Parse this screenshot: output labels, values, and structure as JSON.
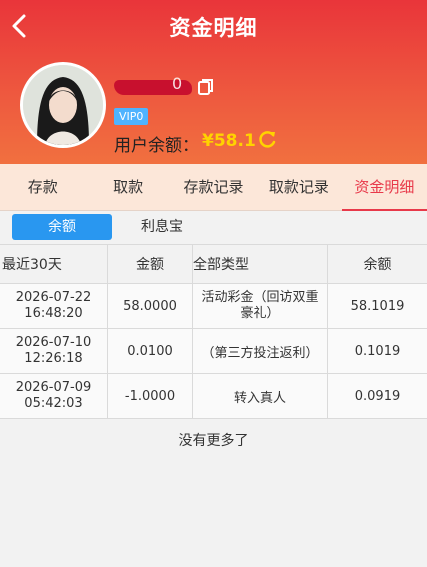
{
  "header": {
    "title": "资金明细",
    "username_suffix": "0",
    "vip": "VIP0",
    "balance_label": "用户余额：",
    "balance_value": "¥58.1"
  },
  "tabs": [
    "存款",
    "取款",
    "存款记录",
    "取款记录",
    "资金明细"
  ],
  "subtabs": [
    "余额",
    "利息宝"
  ],
  "table": {
    "headers": [
      "最近30天",
      "金额",
      "全部类型",
      "余额"
    ],
    "rows": [
      {
        "date": "2026-07-22",
        "time": "16:48:20",
        "amount": "58.0000",
        "type_line1": "活动彩金（回访双重",
        "type_line2": "豪礼）",
        "balance": "58.1019"
      },
      {
        "date": "2026-07-10",
        "time": "12:26:18",
        "amount": "0.0100",
        "type_line1": "（第三方投注返利）",
        "type_line2": "",
        "balance": "0.1019"
      },
      {
        "date": "2026-07-09",
        "time": "05:42:03",
        "amount": "-1.0000",
        "type_line1": "转入真人",
        "type_line2": "",
        "balance": "0.0919"
      }
    ]
  },
  "footer": "没有更多了",
  "colors": {
    "accent": "#e8394a",
    "header_red": "#e9353a",
    "balance_yellow": "#ffd200",
    "vip_blue": "#4fb3ff"
  },
  "icons": {
    "back": "chevron-left-icon",
    "copy": "copy-icon",
    "refresh": "refresh-icon"
  }
}
